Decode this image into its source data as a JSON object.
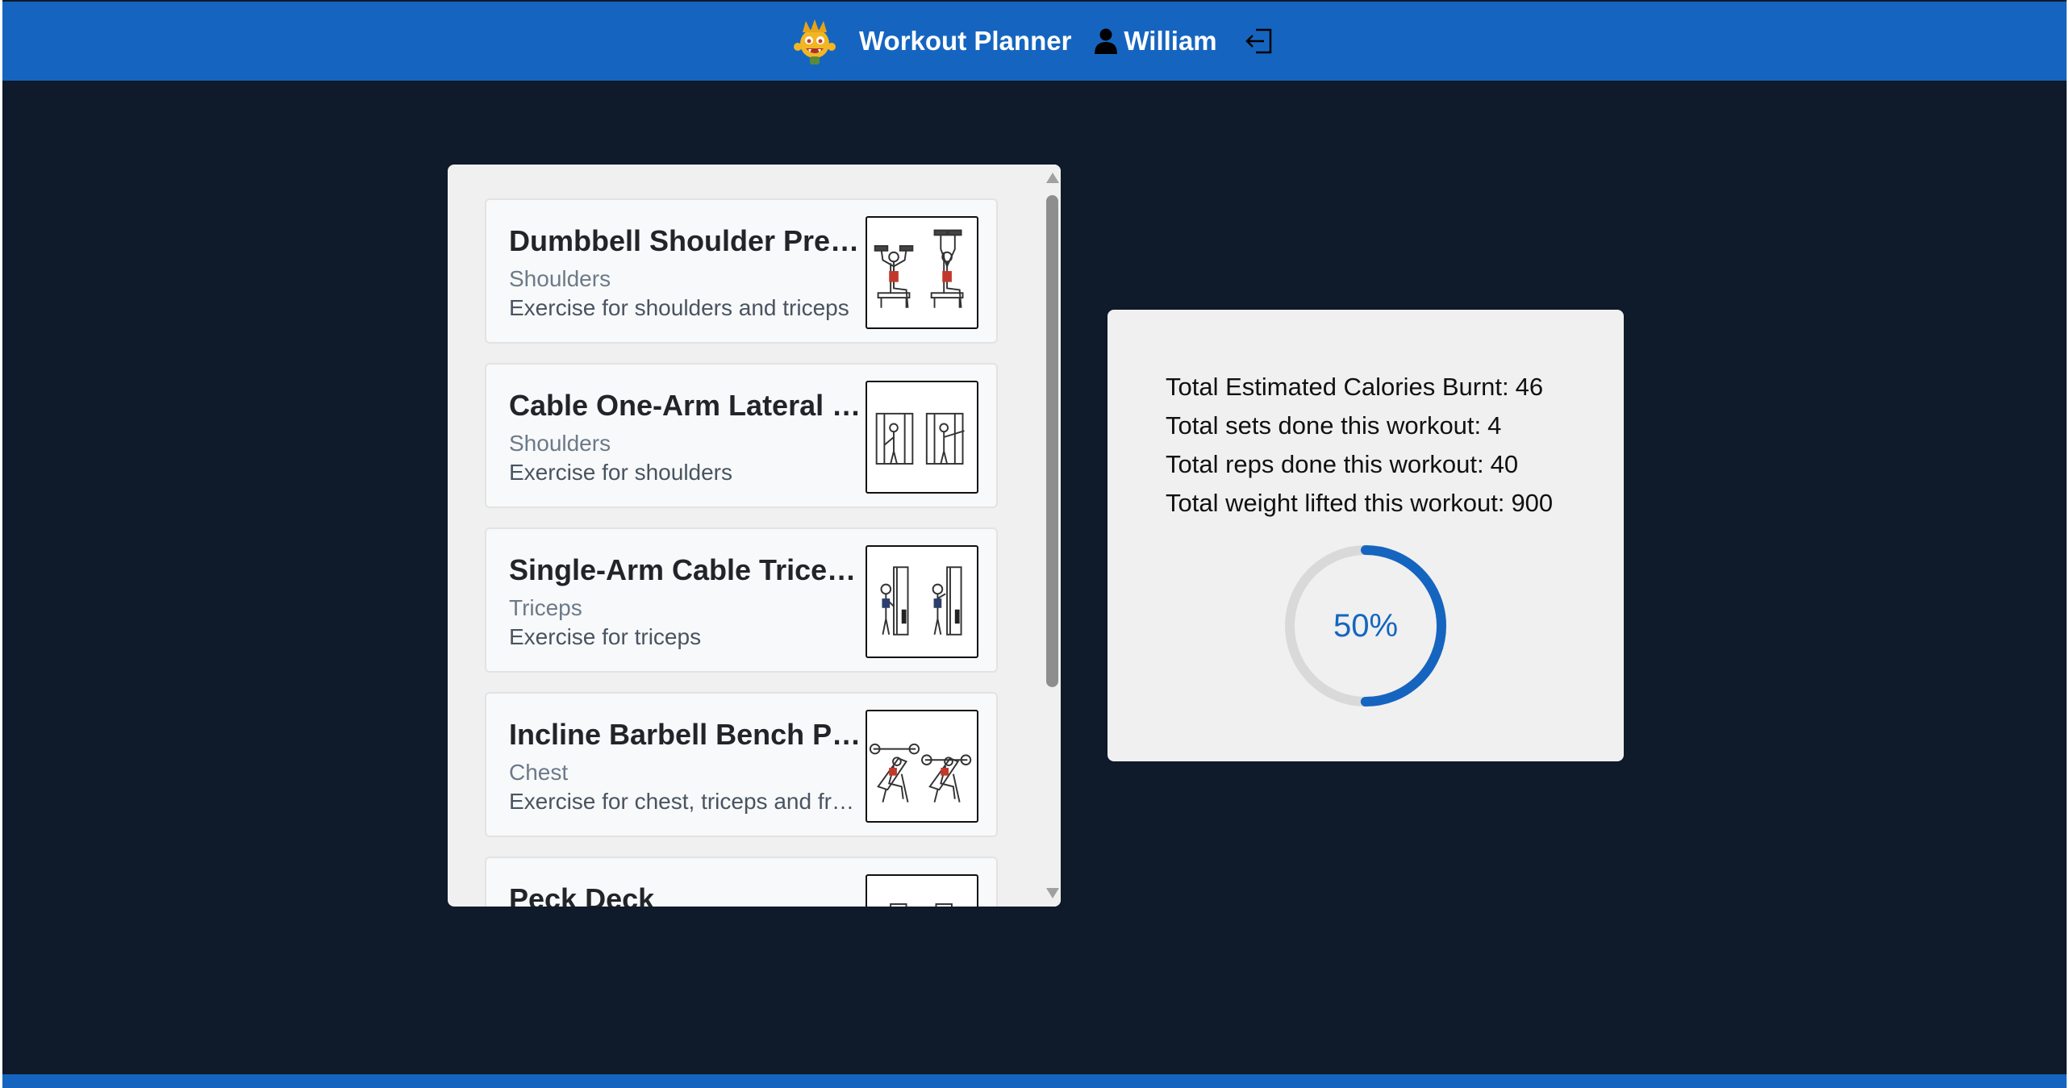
{
  "header": {
    "app_title": "Workout Planner",
    "user_name": "William",
    "icons": [
      "mascot-logo-icon",
      "user-icon",
      "logout-icon"
    ]
  },
  "exercises": [
    {
      "name": "Dumbbell Shoulder Press",
      "muscle": "Shoulders",
      "description": "Exercise for shoulders and triceps"
    },
    {
      "name": "Cable One-Arm Lateral Raise",
      "muscle": "Shoulders",
      "description": "Exercise for shoulders"
    },
    {
      "name": "Single-Arm Cable Triceps Extension",
      "muscle": "Triceps",
      "description": "Exercise for triceps"
    },
    {
      "name": "Incline Barbell Bench Press",
      "muscle": "Chest",
      "description": "Exercise for chest, triceps and front shoulders"
    },
    {
      "name": "Peck Deck",
      "muscle": "",
      "description": ""
    }
  ],
  "stats": {
    "calories_label": "Total Estimated Calories Burnt:",
    "calories_value": "46",
    "sets_label": "Total sets done this workout:",
    "sets_value": "4",
    "reps_label": "Total reps done this workout:",
    "reps_value": "40",
    "weight_label": "Total weight lifted this workout:",
    "weight_value": "900",
    "progress_percent": 50,
    "progress_text": "50%"
  },
  "colors": {
    "header_bg": "#1565c0",
    "page_bg": "#0f1a2a",
    "panel_bg": "#f0f0f0",
    "accent": "#1565c0",
    "progress_track": "#d9d9d9"
  }
}
